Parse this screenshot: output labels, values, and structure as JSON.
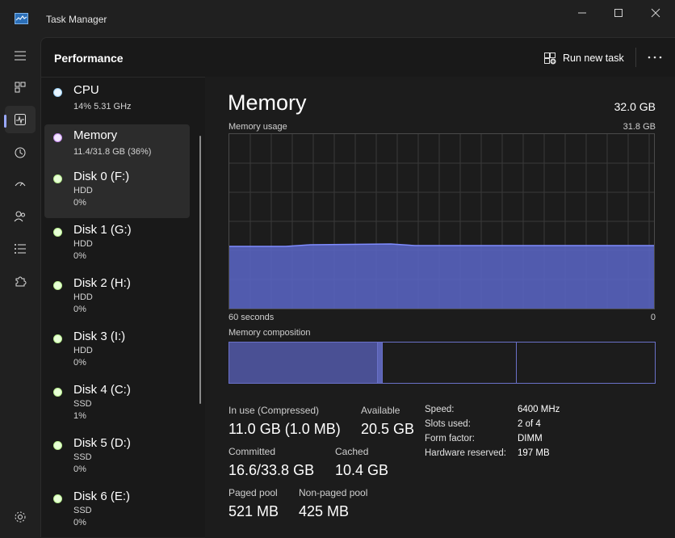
{
  "window": {
    "title": "Task Manager"
  },
  "header": {
    "page_title": "Performance",
    "run_new_task": "Run new task"
  },
  "list": [
    {
      "name": "CPU",
      "line1": "14%  5.31 GHz",
      "line2": "",
      "dot": "#9ad0f5"
    },
    {
      "name": "Memory",
      "line1": "11.4/31.8 GB (36%)",
      "line2": "",
      "dot": "#c78ef0"
    },
    {
      "name": "Disk 0 (F:)",
      "line1": "HDD",
      "line2": "0%",
      "dot": "#b9ef8f"
    },
    {
      "name": "Disk 1 (G:)",
      "line1": "HDD",
      "line2": "0%",
      "dot": "#b9ef8f"
    },
    {
      "name": "Disk 2 (H:)",
      "line1": "HDD",
      "line2": "0%",
      "dot": "#b9ef8f"
    },
    {
      "name": "Disk 3 (I:)",
      "line1": "HDD",
      "line2": "0%",
      "dot": "#b9ef8f"
    },
    {
      "name": "Disk 4 (C:)",
      "line1": "SSD",
      "line2": "1%",
      "dot": "#b9ef8f"
    },
    {
      "name": "Disk 5 (D:)",
      "line1": "SSD",
      "line2": "0%",
      "dot": "#b9ef8f"
    },
    {
      "name": "Disk 6 (E:)",
      "line1": "SSD",
      "line2": "0%",
      "dot": "#b9ef8f"
    }
  ],
  "detail": {
    "title": "Memory",
    "total": "32.0 GB",
    "usage_label": "Memory usage",
    "usage_max": "31.8 GB",
    "time_left": "60 seconds",
    "time_right": "0",
    "composition_label": "Memory composition",
    "stats": {
      "in_use_label": "In use (Compressed)",
      "in_use_value": "11.0 GB (1.0 MB)",
      "available_label": "Available",
      "available_value": "20.5 GB",
      "committed_label": "Committed",
      "committed_value": "16.6/33.8 GB",
      "cached_label": "Cached",
      "cached_value": "10.4 GB",
      "paged_label": "Paged pool",
      "paged_value": "521 MB",
      "nonpaged_label": "Non-paged pool",
      "nonpaged_value": "425 MB"
    },
    "specs": {
      "speed_label": "Speed:",
      "speed_value": "6400 MHz",
      "slots_label": "Slots used:",
      "slots_value": "2 of 4",
      "form_label": "Form factor:",
      "form_value": "DIMM",
      "reserved_label": "Hardware reserved:",
      "reserved_value": "197 MB"
    }
  },
  "colors": {
    "accent": "#6f7cf0",
    "graph_fill": "#5a66c8",
    "graph_line": "#7f8cff"
  },
  "icons": [
    "task-manager-icon",
    "minimize-icon",
    "maximize-icon",
    "close-icon",
    "hamburger-icon",
    "processes-icon",
    "performance-icon",
    "app-history-icon",
    "startup-apps-icon",
    "users-icon",
    "details-icon",
    "services-icon",
    "settings-icon",
    "run-task-icon",
    "more-icon"
  ]
}
